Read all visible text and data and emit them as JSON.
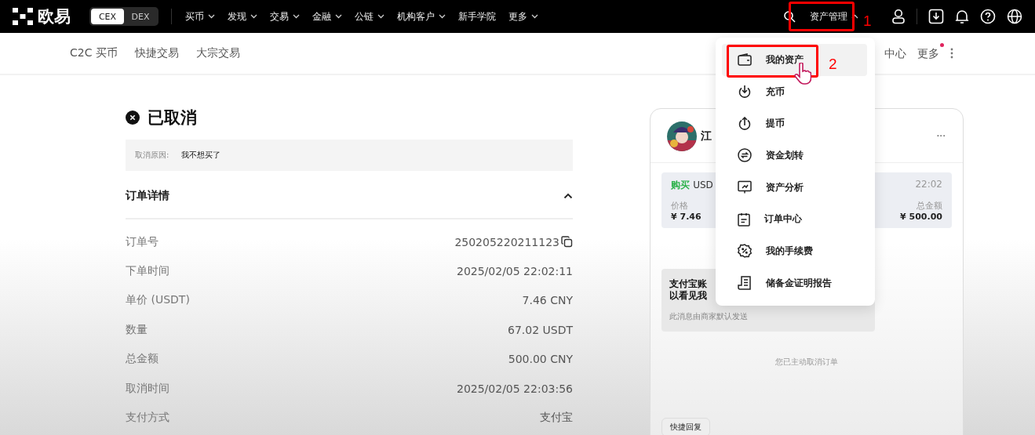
{
  "top_nav": {
    "logo": "欧易",
    "mode_toggle": [
      {
        "label": "CEX",
        "selected": true
      },
      {
        "label": "DEX",
        "selected": false
      }
    ],
    "menu": [
      {
        "label": "买币",
        "has_dropdown": true
      },
      {
        "label": "发现",
        "has_dropdown": true
      },
      {
        "label": "交易",
        "has_dropdown": true
      },
      {
        "label": "金融",
        "has_dropdown": true
      },
      {
        "label": "公链",
        "has_dropdown": true
      },
      {
        "label": "机构客户",
        "has_dropdown": true
      },
      {
        "label": "新手学院",
        "has_dropdown": false
      },
      {
        "label": "更多",
        "has_dropdown": true
      }
    ],
    "asset_menu": {
      "label": "资产管理",
      "expanded": true
    }
  },
  "sub_nav": {
    "items": [
      "C2C 买币",
      "快捷交易",
      "大宗交易"
    ],
    "right_items": [
      {
        "label": "中心",
        "notify": false
      },
      {
        "label": "更多",
        "notify": true
      }
    ]
  },
  "order": {
    "status": "已取消",
    "reason_label": "取消原因:",
    "reason": "我不想买了",
    "section_title": "订单详情",
    "section_expanded": true,
    "rows": [
      {
        "label": "订单号",
        "value": "250205220211123",
        "copyable": true
      },
      {
        "label": "下单时间",
        "value": "2025/02/05 22:02:11",
        "copyable": false
      },
      {
        "label": "单价 (USDT)",
        "value": "7.46 CNY",
        "copyable": false
      },
      {
        "label": "数量",
        "value": "67.02 USDT",
        "copyable": false
      },
      {
        "label": "总金额",
        "value": "500.00 CNY",
        "copyable": false
      },
      {
        "label": "取消时间",
        "value": "2025/02/05 22:03:56",
        "copyable": false
      },
      {
        "label": "支付方式",
        "value": "支付宝",
        "copyable": false
      }
    ]
  },
  "chat": {
    "merchant_name": "江",
    "more": "···",
    "summary": {
      "side": "购买",
      "asset": "USD",
      "time": "22:02",
      "price_label": "价格",
      "price": "¥ 7.46",
      "total_label": "总金额",
      "total": "¥ 500.00"
    },
    "message": {
      "lines": [
        "支付宝账",
        "以看见我"
      ],
      "note": "此消息由商家默认发送"
    },
    "system_note": "您已主动取消订单",
    "quick_reply": "快捷回复"
  },
  "asset_dropdown": [
    {
      "label": "我的资产",
      "kind": "wallet",
      "selected": true
    },
    {
      "label": "充币",
      "kind": "deposit",
      "selected": false
    },
    {
      "label": "提币",
      "kind": "withdraw",
      "selected": false
    },
    {
      "label": "资金划转",
      "kind": "transfer",
      "selected": false
    },
    {
      "label": "资产分析",
      "kind": "analysis",
      "selected": false
    },
    {
      "label": "订单中心",
      "kind": "orders",
      "selected": false
    },
    {
      "label": "我的手续费",
      "kind": "fee",
      "selected": false
    },
    {
      "label": "储备金证明报告",
      "kind": "report",
      "selected": false
    }
  ],
  "annotations": [
    {
      "label": "1"
    },
    {
      "label": "2"
    }
  ]
}
